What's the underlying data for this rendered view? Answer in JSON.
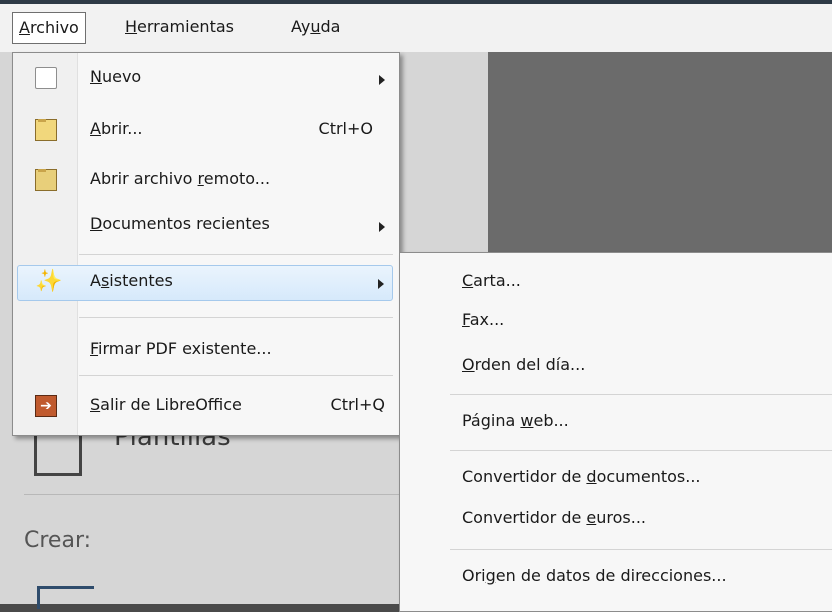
{
  "menubar": {
    "archivo": {
      "pre": "",
      "u": "A",
      "post": "rchivo"
    },
    "herramientas": {
      "pre": "",
      "u": "H",
      "post": "erramientas"
    },
    "ayuda": {
      "pre": "Ay",
      "u": "u",
      "post": "da"
    }
  },
  "start_center": {
    "plantillas": "Plantillas",
    "crear": "Crear:"
  },
  "file_menu": {
    "nuevo": {
      "pre": "",
      "u": "N",
      "post": "uevo"
    },
    "abrir": {
      "pre": "",
      "u": "A",
      "post": "brir...",
      "shortcut": "Ctrl+O"
    },
    "abrir_remoto": {
      "pre": "Abrir archivo ",
      "u": "r",
      "post": "emoto..."
    },
    "recientes": {
      "pre": "",
      "u": "D",
      "post": "ocumentos recientes"
    },
    "asistentes": {
      "pre": "A",
      "u": "s",
      "post": "istentes"
    },
    "firmar": {
      "pre": "",
      "u": "F",
      "post": "irmar PDF existente..."
    },
    "salir": {
      "pre": "",
      "u": "S",
      "post": "alir de LibreOffice",
      "shortcut": "Ctrl+Q"
    }
  },
  "wizards_submenu": {
    "carta": {
      "pre": "",
      "u": "C",
      "post": "arta..."
    },
    "fax": {
      "pre": "",
      "u": "F",
      "post": "ax..."
    },
    "orden": {
      "pre": "",
      "u": "O",
      "post": "rden del día..."
    },
    "pagina_web": {
      "pre": "Página ",
      "u": "w",
      "post": "eb..."
    },
    "conv_docs": {
      "pre": "Convertidor de ",
      "u": "d",
      "post": "ocumentos..."
    },
    "conv_euros": {
      "pre": "Convertidor de ",
      "u": "e",
      "post": "uros..."
    },
    "origen": {
      "pre": "Ori",
      "u": "g",
      "post": "en de datos de direcciones..."
    }
  }
}
